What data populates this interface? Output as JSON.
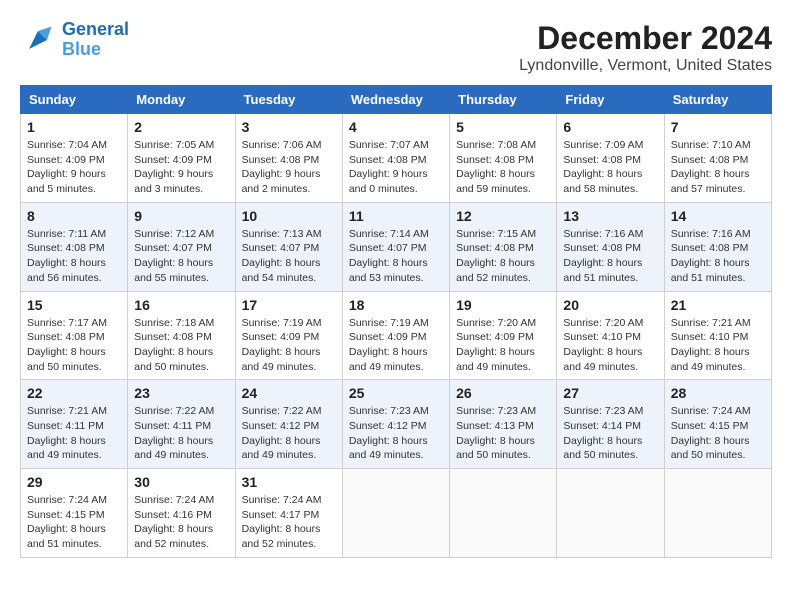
{
  "header": {
    "logo_line1": "General",
    "logo_line2": "Blue",
    "title": "December 2024",
    "subtitle": "Lyndonville, Vermont, United States"
  },
  "columns": [
    "Sunday",
    "Monday",
    "Tuesday",
    "Wednesday",
    "Thursday",
    "Friday",
    "Saturday"
  ],
  "weeks": [
    [
      {
        "day": "1",
        "sunrise": "Sunrise: 7:04 AM",
        "sunset": "Sunset: 4:09 PM",
        "daylight": "Daylight: 9 hours and 5 minutes."
      },
      {
        "day": "2",
        "sunrise": "Sunrise: 7:05 AM",
        "sunset": "Sunset: 4:09 PM",
        "daylight": "Daylight: 9 hours and 3 minutes."
      },
      {
        "day": "3",
        "sunrise": "Sunrise: 7:06 AM",
        "sunset": "Sunset: 4:08 PM",
        "daylight": "Daylight: 9 hours and 2 minutes."
      },
      {
        "day": "4",
        "sunrise": "Sunrise: 7:07 AM",
        "sunset": "Sunset: 4:08 PM",
        "daylight": "Daylight: 9 hours and 0 minutes."
      },
      {
        "day": "5",
        "sunrise": "Sunrise: 7:08 AM",
        "sunset": "Sunset: 4:08 PM",
        "daylight": "Daylight: 8 hours and 59 minutes."
      },
      {
        "day": "6",
        "sunrise": "Sunrise: 7:09 AM",
        "sunset": "Sunset: 4:08 PM",
        "daylight": "Daylight: 8 hours and 58 minutes."
      },
      {
        "day": "7",
        "sunrise": "Sunrise: 7:10 AM",
        "sunset": "Sunset: 4:08 PM",
        "daylight": "Daylight: 8 hours and 57 minutes."
      }
    ],
    [
      {
        "day": "8",
        "sunrise": "Sunrise: 7:11 AM",
        "sunset": "Sunset: 4:08 PM",
        "daylight": "Daylight: 8 hours and 56 minutes."
      },
      {
        "day": "9",
        "sunrise": "Sunrise: 7:12 AM",
        "sunset": "Sunset: 4:07 PM",
        "daylight": "Daylight: 8 hours and 55 minutes."
      },
      {
        "day": "10",
        "sunrise": "Sunrise: 7:13 AM",
        "sunset": "Sunset: 4:07 PM",
        "daylight": "Daylight: 8 hours and 54 minutes."
      },
      {
        "day": "11",
        "sunrise": "Sunrise: 7:14 AM",
        "sunset": "Sunset: 4:07 PM",
        "daylight": "Daylight: 8 hours and 53 minutes."
      },
      {
        "day": "12",
        "sunrise": "Sunrise: 7:15 AM",
        "sunset": "Sunset: 4:08 PM",
        "daylight": "Daylight: 8 hours and 52 minutes."
      },
      {
        "day": "13",
        "sunrise": "Sunrise: 7:16 AM",
        "sunset": "Sunset: 4:08 PM",
        "daylight": "Daylight: 8 hours and 51 minutes."
      },
      {
        "day": "14",
        "sunrise": "Sunrise: 7:16 AM",
        "sunset": "Sunset: 4:08 PM",
        "daylight": "Daylight: 8 hours and 51 minutes."
      }
    ],
    [
      {
        "day": "15",
        "sunrise": "Sunrise: 7:17 AM",
        "sunset": "Sunset: 4:08 PM",
        "daylight": "Daylight: 8 hours and 50 minutes."
      },
      {
        "day": "16",
        "sunrise": "Sunrise: 7:18 AM",
        "sunset": "Sunset: 4:08 PM",
        "daylight": "Daylight: 8 hours and 50 minutes."
      },
      {
        "day": "17",
        "sunrise": "Sunrise: 7:19 AM",
        "sunset": "Sunset: 4:09 PM",
        "daylight": "Daylight: 8 hours and 49 minutes."
      },
      {
        "day": "18",
        "sunrise": "Sunrise: 7:19 AM",
        "sunset": "Sunset: 4:09 PM",
        "daylight": "Daylight: 8 hours and 49 minutes."
      },
      {
        "day": "19",
        "sunrise": "Sunrise: 7:20 AM",
        "sunset": "Sunset: 4:09 PM",
        "daylight": "Daylight: 8 hours and 49 minutes."
      },
      {
        "day": "20",
        "sunrise": "Sunrise: 7:20 AM",
        "sunset": "Sunset: 4:10 PM",
        "daylight": "Daylight: 8 hours and 49 minutes."
      },
      {
        "day": "21",
        "sunrise": "Sunrise: 7:21 AM",
        "sunset": "Sunset: 4:10 PM",
        "daylight": "Daylight: 8 hours and 49 minutes."
      }
    ],
    [
      {
        "day": "22",
        "sunrise": "Sunrise: 7:21 AM",
        "sunset": "Sunset: 4:11 PM",
        "daylight": "Daylight: 8 hours and 49 minutes."
      },
      {
        "day": "23",
        "sunrise": "Sunrise: 7:22 AM",
        "sunset": "Sunset: 4:11 PM",
        "daylight": "Daylight: 8 hours and 49 minutes."
      },
      {
        "day": "24",
        "sunrise": "Sunrise: 7:22 AM",
        "sunset": "Sunset: 4:12 PM",
        "daylight": "Daylight: 8 hours and 49 minutes."
      },
      {
        "day": "25",
        "sunrise": "Sunrise: 7:23 AM",
        "sunset": "Sunset: 4:12 PM",
        "daylight": "Daylight: 8 hours and 49 minutes."
      },
      {
        "day": "26",
        "sunrise": "Sunrise: 7:23 AM",
        "sunset": "Sunset: 4:13 PM",
        "daylight": "Daylight: 8 hours and 50 minutes."
      },
      {
        "day": "27",
        "sunrise": "Sunrise: 7:23 AM",
        "sunset": "Sunset: 4:14 PM",
        "daylight": "Daylight: 8 hours and 50 minutes."
      },
      {
        "day": "28",
        "sunrise": "Sunrise: 7:24 AM",
        "sunset": "Sunset: 4:15 PM",
        "daylight": "Daylight: 8 hours and 50 minutes."
      }
    ],
    [
      {
        "day": "29",
        "sunrise": "Sunrise: 7:24 AM",
        "sunset": "Sunset: 4:15 PM",
        "daylight": "Daylight: 8 hours and 51 minutes."
      },
      {
        "day": "30",
        "sunrise": "Sunrise: 7:24 AM",
        "sunset": "Sunset: 4:16 PM",
        "daylight": "Daylight: 8 hours and 52 minutes."
      },
      {
        "day": "31",
        "sunrise": "Sunrise: 7:24 AM",
        "sunset": "Sunset: 4:17 PM",
        "daylight": "Daylight: 8 hours and 52 minutes."
      },
      null,
      null,
      null,
      null
    ]
  ]
}
